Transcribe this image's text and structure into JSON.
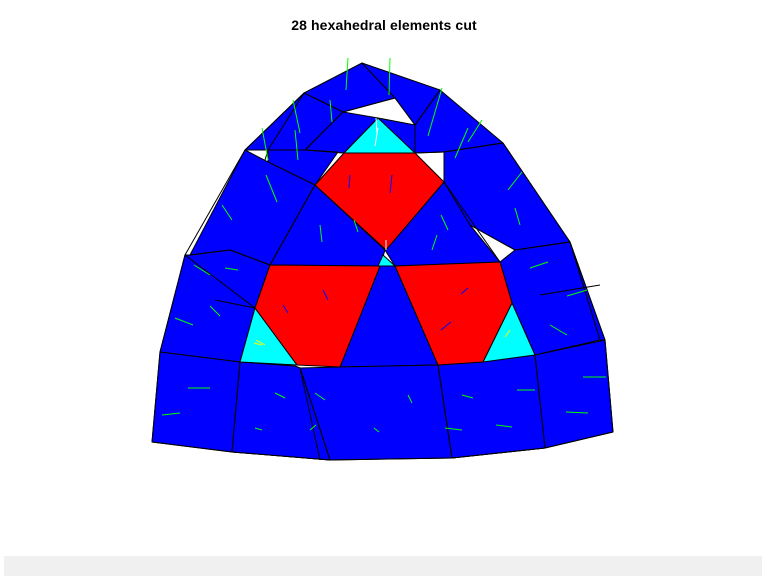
{
  "figure": {
    "title": "28 hexahedral elements cut"
  },
  "colors": {
    "element_blue": "#0000ff",
    "cut_red": "#ff0000",
    "cut_cyan": "#00ffff",
    "edge": "#000000",
    "normal_green": "#00ff00",
    "normal_blue": "#0000ff",
    "normal_white": "#ffffff",
    "normal_yellow": "#ffff00",
    "figure_background": "#ffffff",
    "strip_background": "#f0f0f0"
  },
  "legend": {
    "cut_faces": "red",
    "cut_partial_faces": "cyan",
    "uncut_faces": "blue"
  }
}
